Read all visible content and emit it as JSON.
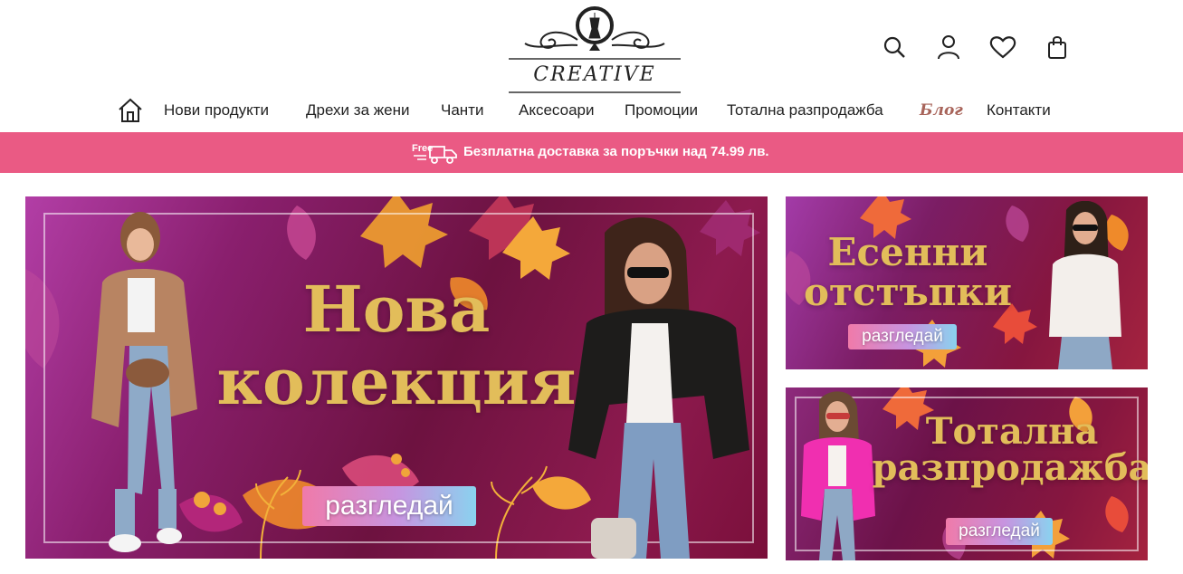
{
  "brand": {
    "logo_text": "CREATIVE"
  },
  "header_icons": [
    {
      "icon": "search-icon"
    },
    {
      "icon": "user-icon"
    },
    {
      "icon": "heart-icon"
    },
    {
      "icon": "shopping-bag-icon"
    }
  ],
  "nav": {
    "home_icon": "home-icon",
    "items": [
      {
        "label": "Нови продукти"
      },
      {
        "label": "Дрехи за жени"
      },
      {
        "label": "Чанти"
      },
      {
        "label": "Аксесоари"
      },
      {
        "label": "Промоции"
      },
      {
        "label": "Тотална разпродажба"
      },
      {
        "label": "Блог"
      },
      {
        "label": "Контакти"
      }
    ]
  },
  "promo": {
    "badge": "Free",
    "text": "Безплатна доставка за поръчки над 74.99 лв.",
    "background": "#ea5a84"
  },
  "banners": {
    "main": {
      "line1": "Нова",
      "line2": "колекция",
      "cta": "разгледай"
    },
    "side1": {
      "line1": "Есенни",
      "line2": "отстъпки",
      "cta": "разгледай"
    },
    "side2": {
      "line1": "Тотална",
      "line2": "разпродажба",
      "cta": "разгледай"
    }
  },
  "colors": {
    "accent_gold": "#e2bd5a",
    "blog_link": "#a8645a",
    "banner_purple": "#6d1240"
  }
}
